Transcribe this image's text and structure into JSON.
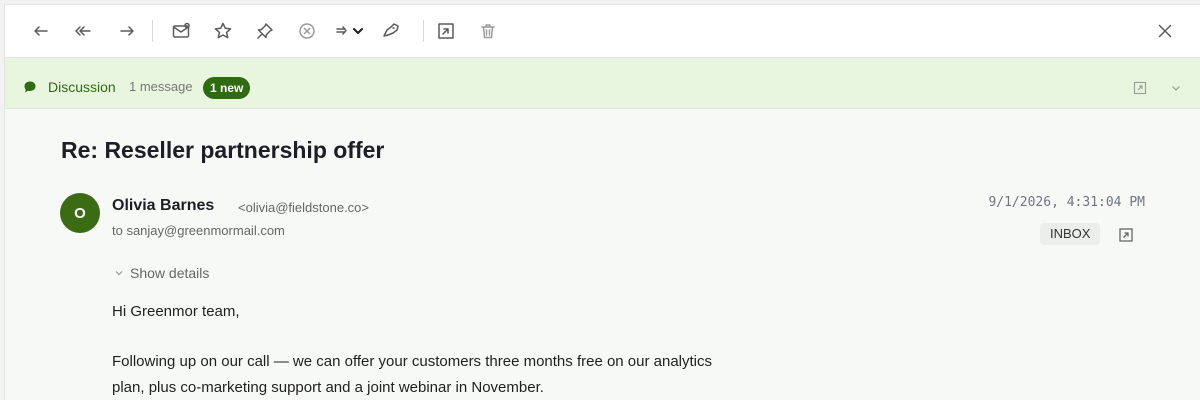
{
  "toolbar": {
    "buttons": [
      {
        "name": "reply-button",
        "icon": "reply-icon"
      },
      {
        "name": "reply-all-button",
        "icon": "reply-all-icon"
      },
      {
        "name": "forward-button",
        "icon": "forward-icon"
      },
      {
        "name": "mark-unread-button",
        "icon": "envelope-icon"
      },
      {
        "name": "star-button",
        "icon": "star-icon"
      },
      {
        "name": "pin-button",
        "icon": "pin-icon"
      },
      {
        "name": "spam-button",
        "icon": "x-circle-icon"
      },
      {
        "name": "move-button",
        "icon": "arrow-right-icon"
      },
      {
        "name": "tag-button",
        "icon": "tag-icon"
      },
      {
        "name": "open-window-button",
        "icon": "open-external-icon"
      },
      {
        "name": "delete-button",
        "icon": "trash-icon"
      },
      {
        "name": "close-button",
        "icon": "close-icon"
      }
    ]
  },
  "discussion": {
    "label": "Discussion",
    "count": "1 message",
    "badge": "1 new"
  },
  "message": {
    "subject": "Re: Reseller partnership offer",
    "avatar_initial": "O",
    "sender_name": "Olivia Barnes",
    "sender_email": "<olivia@fieldstone.co>",
    "recipient": "to sanjay@greenmormail.com",
    "date": "9/1/2026, 4:31:04 PM",
    "folder": "INBOX",
    "show_details": "Show details",
    "greeting": "Hi Greenmor team,",
    "body": "Following up on our call — we can offer your customers three months free on our analytics plan, plus co-marketing support and a joint webinar in November."
  },
  "colors": {
    "accent": "#2f6b10",
    "discussion_bg": "#e9f6df",
    "avatar_bg": "#3b6b12"
  }
}
